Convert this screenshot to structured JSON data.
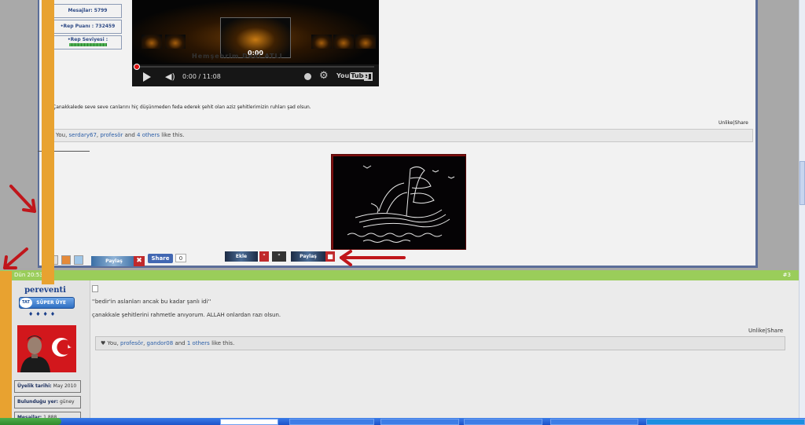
{
  "post1": {
    "stats": {
      "messages": "Mesajlar: 5799",
      "rep_points": "•Rep Puanı : 732459",
      "rep_level_label": "•Rep Seviyesi :"
    },
    "video": {
      "center_time": "0:00",
      "ghost_title": "Hemşehrim Dedi ATLI",
      "time": "0:00 / 11:08",
      "progress_fraction": 0.0,
      "logo_text": "You",
      "logo_tube": "Tube"
    },
    "text": "Çanakkalede seve seve canlarını hiç düşünmeden feda ederek şehit olan aziz şehitlerimizin ruhları şad olsun.",
    "actions": "Unlike|Share",
    "likes": {
      "prefix": "You,",
      "user1": "serdary67",
      "user2": "profesör",
      "and": "and",
      "others": "4 others",
      "suffix": "like this."
    },
    "share_strip": {
      "banner1": "Paylaş",
      "x_label": "✖",
      "fb_label": "Share",
      "fb_count": "0",
      "banner2": "Ekle",
      "banner3": "Paylaş",
      "quote_glyph": "\""
    }
  },
  "post2": {
    "header_date": "Dün 20:53",
    "post_number": "#3",
    "username": "pereventi",
    "rank_label": "SÜPER ÜYE",
    "rank_logo": "TAT",
    "rep_stars": "♦♦♦♦",
    "info": {
      "join_label": "Üyelik tarihi:",
      "join_value": "May 2010",
      "location_label": "Bulunduğu yer:",
      "location_value": "güney",
      "messages_label": "Mesajlar:",
      "messages_value": "1.888"
    },
    "quote": "''bedir'in aslanları ancak bu kadar şanlı idi''",
    "text": "çanakkale şehitlerini rahmetle anıyorum. ALLAH onlardan razı olsun.",
    "actions": "Unlike|Share",
    "likes": {
      "heart": "♥",
      "prefix": "You,",
      "user1": "profesör",
      "user2": "gandor08",
      "and": "and",
      "others": "1 others",
      "suffix": "like this."
    }
  },
  "colors": {
    "post_header": "#9acd5a",
    "annotation_orange": "#e8a230",
    "annotation_arrow": "#c0161b",
    "link_blue": "#2c5fa8",
    "username_blue": "#1a3f8a"
  }
}
